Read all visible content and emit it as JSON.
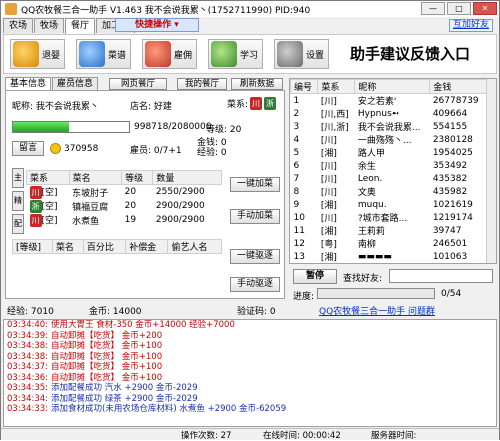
{
  "window": {
    "title": "QQ农牧餐三合一助手 V1.463   我不会说我累丶(1752711990)   PID:940",
    "minimize": "—",
    "maximize": "□",
    "close": "✕"
  },
  "top_tabs": [
    "农场",
    "牧场",
    "餐厅",
    "加工坊"
  ],
  "quick_action": "快捷操作 ▾",
  "link_button": "互加好友",
  "toolbar": {
    "buttons": [
      "退婴",
      "菜谱",
      "雇佣",
      "学习",
      "设置"
    ],
    "feedback": "助手建议反馈入口"
  },
  "sub_tabs": [
    "基本信息",
    "雇员信息"
  ],
  "sub_buttons": [
    "网页餐厅",
    "我的餐厅",
    "刷新数据"
  ],
  "basic": {
    "nickname": "昵称: 我不会说我累丶",
    "store": "店名: 好建",
    "cuisine_label": "菜系:",
    "cuisine_badges": [
      "川",
      "浙"
    ],
    "exp_progress": 0.48,
    "exp_text": "998718/2080000",
    "level": "等级:    20",
    "leave_button": "留言",
    "coins": "370958",
    "employees": "雇员: 0/7+1",
    "gold": "金钱: 0",
    "exp_lbl": "经验: 0"
  },
  "side_buttons": [
    "主",
    "精",
    "配"
  ],
  "dish_table": {
    "headers": [
      "菜系",
      "菜名",
      "等级",
      "数量"
    ],
    "rows": [
      {
        "cuisine": "川",
        "tag": "[空]",
        "name": "东坡肘子",
        "level": "20",
        "qty": "2550/2900"
      },
      {
        "cuisine": "浙",
        "tag": "[空]",
        "name": "镇福豆腐",
        "level": "20",
        "qty": "2900/2900"
      },
      {
        "cuisine": "川",
        "tag": "[空]",
        "name": "水煮鱼",
        "level": "19",
        "qty": "2900/2900"
      }
    ]
  },
  "dish_buttons": [
    "一键加菜",
    "手动加菜"
  ],
  "rank_table": {
    "headers": [
      "[等级]",
      "菜名",
      "百分比",
      "补偿金",
      "偷艺人名"
    ]
  },
  "rank_buttons": [
    "一键驱逐",
    "手动驱逐"
  ],
  "friends_table": {
    "headers": [
      "编号",
      "菜系",
      "昵称",
      "金钱"
    ],
    "rows": [
      {
        "id": "1",
        "cuisine": "[川]",
        "name": "安之若素'",
        "money": "26778739"
      },
      {
        "id": "2",
        "cuisine": "[川,西]",
        "name": "Hypnus➻",
        "money": "409664"
      },
      {
        "id": "3",
        "cuisine": "[川,浙]",
        "name": "我不会说我累...",
        "money": "554155"
      },
      {
        "id": "4",
        "cuisine": "[川]",
        "name": "一曲殇殇丶...",
        "money": "2380128"
      },
      {
        "id": "5",
        "cuisine": "[湘]",
        "name": "路人甲",
        "money": "1954025"
      },
      {
        "id": "6",
        "cuisine": "[川]",
        "name": "余生",
        "money": "353492"
      },
      {
        "id": "7",
        "cuisine": "[川]",
        "name": "Leon.",
        "money": "435382"
      },
      {
        "id": "8",
        "cuisine": "[川]",
        "name": "文奥",
        "money": "435982"
      },
      {
        "id": "9",
        "cuisine": "[湘]",
        "name": "muqu.",
        "money": "1021619"
      },
      {
        "id": "10",
        "cuisine": "[川]",
        "name": "?城市套路...",
        "money": "1219174"
      },
      {
        "id": "11",
        "cuisine": "[湘]",
        "name": "王莉莉",
        "money": "39747"
      },
      {
        "id": "12",
        "cuisine": "[粤]",
        "name": "南柳",
        "money": "246501"
      },
      {
        "id": "13",
        "cuisine": "[湘]",
        "name": "▬▬▬▬",
        "money": "101063"
      }
    ]
  },
  "pause_button": "暂停",
  "search_label": "查找好友:",
  "progress_label": "进度:",
  "progress_value": "0/54",
  "stats": {
    "exp": "经验:   7010",
    "gold": "金币:   14000",
    "verify": "验证码:     0",
    "help_link": "QQ农牧餐三合一助手 问题群"
  },
  "log": [
    {
      "time": "03:34:40:",
      "msg": "使用大胃王 食材-350 金币+14000 经验+7000",
      "color": "red"
    },
    {
      "time": "03:34:39:",
      "msg": "自动卸摊【吃货】 金币+200",
      "color": "red"
    },
    {
      "time": "03:34:38:",
      "msg": "自动卸摊【吃货】 金币+100",
      "color": "red"
    },
    {
      "time": "03:34:38:",
      "msg": "自动卸摊【吃货】 金币+100",
      "color": "red"
    },
    {
      "time": "03:34:37:",
      "msg": "自动卸摊【吃货】 金币+100",
      "color": "red"
    },
    {
      "time": "03:34:36:",
      "msg": "自动卸摊【吃货】 金币+100",
      "color": "red"
    },
    {
      "time": "03:34:35:",
      "msg": "添加配餐成功  汽水 +2900  金币-2029",
      "color": "blue"
    },
    {
      "time": "03:34:34:",
      "msg": "添加配餐成功  绿茶 +2900  金币-2029",
      "color": "blue"
    },
    {
      "time": "03:34:33:",
      "msg": "添加食材成功(未用农场仓库材料)  水煮鱼 +2900  金币-62059",
      "color": "blue"
    }
  ],
  "statusbar": {
    "ops": "操作次数:  27",
    "online": "在线时间:    00:00:42",
    "server": "服务器时间:"
  }
}
